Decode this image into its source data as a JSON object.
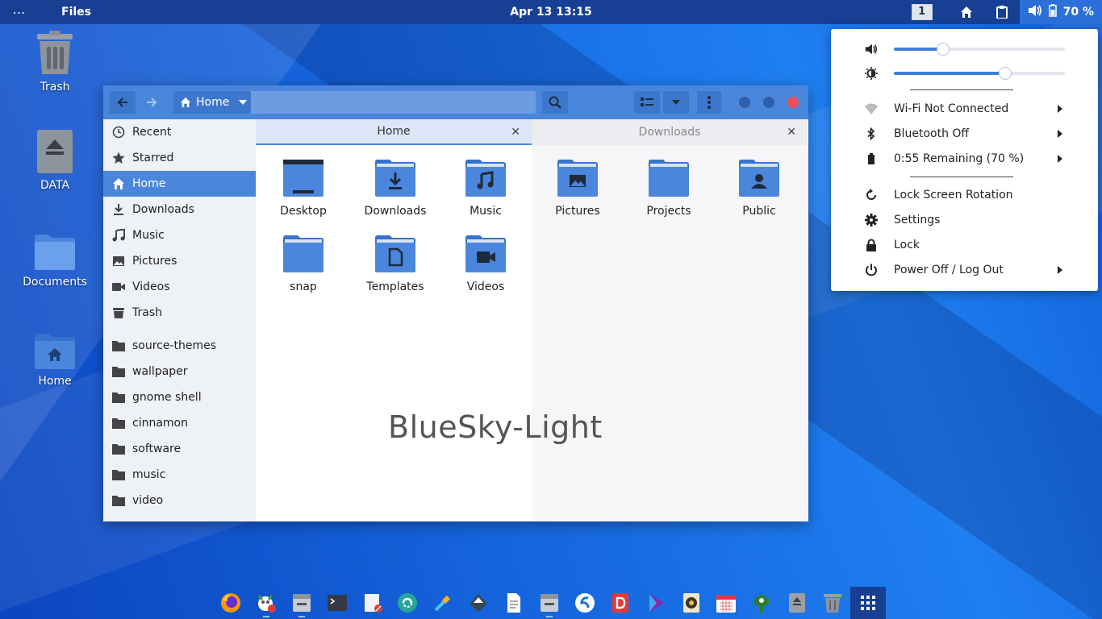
{
  "topbar": {
    "activities_label": "⋯",
    "app_name": "Files",
    "clock": "Apr 13  13:15",
    "workspace": "1",
    "battery": "70 %"
  },
  "desktop_icons": [
    {
      "label": "Trash",
      "icon": "trash-icon"
    },
    {
      "label": "DATA",
      "icon": "drive-icon"
    },
    {
      "label": "Documents",
      "icon": "folder-icon"
    },
    {
      "label": "Home",
      "icon": "home-folder-icon"
    }
  ],
  "window": {
    "path_current": "Home",
    "sidebar": {
      "places": [
        {
          "label": "Recent",
          "icon": "clock-icon"
        },
        {
          "label": "Starred",
          "icon": "star-icon"
        },
        {
          "label": "Home",
          "icon": "home-icon",
          "active": true
        },
        {
          "label": "Downloads",
          "icon": "download-icon"
        },
        {
          "label": "Music",
          "icon": "music-icon"
        },
        {
          "label": "Pictures",
          "icon": "picture-icon"
        },
        {
          "label": "Videos",
          "icon": "video-icon"
        },
        {
          "label": "Trash",
          "icon": "trash-icon"
        }
      ],
      "bookmarks": [
        {
          "label": "source-themes"
        },
        {
          "label": "wallpaper"
        },
        {
          "label": "gnome shell"
        },
        {
          "label": "cinnamon"
        },
        {
          "label": "software"
        },
        {
          "label": "music"
        },
        {
          "label": "video"
        }
      ]
    },
    "tabs": [
      {
        "label": "Home",
        "active": true
      },
      {
        "label": "Downloads",
        "active": false
      }
    ],
    "files": [
      {
        "label": "Desktop",
        "icon": "desktop-folder-icon"
      },
      {
        "label": "Downloads",
        "icon": "downloads-folder-icon"
      },
      {
        "label": "Music",
        "icon": "music-folder-icon"
      },
      {
        "label": "Pictures",
        "icon": "pictures-folder-icon"
      },
      {
        "label": "Projects",
        "icon": "folder-icon"
      },
      {
        "label": "Public",
        "icon": "public-folder-icon"
      },
      {
        "label": "snap",
        "icon": "folder-icon"
      },
      {
        "label": "Templates",
        "icon": "templates-folder-icon"
      },
      {
        "label": "Videos",
        "icon": "videos-folder-icon"
      }
    ],
    "watermark": "BlueSky-Light"
  },
  "system_menu": {
    "volume_level": 0.29,
    "brightness_level": 0.65,
    "items": [
      {
        "label": "Wi-Fi Not Connected",
        "icon": "wifi-icon",
        "submenu": true
      },
      {
        "label": "Bluetooth Off",
        "icon": "bluetooth-icon",
        "submenu": true
      },
      {
        "label": "0:55 Remaining (70 %)",
        "icon": "battery-icon",
        "submenu": true
      },
      {
        "label": "Lock Screen Rotation",
        "icon": "rotation-icon",
        "submenu": false
      },
      {
        "label": "Settings",
        "icon": "gear-icon",
        "submenu": false
      },
      {
        "label": "Lock",
        "icon": "lock-icon",
        "submenu": false
      },
      {
        "label": "Power Off / Log Out",
        "icon": "power-icon",
        "submenu": true
      }
    ]
  },
  "colors": {
    "accent": "#4a86dc",
    "topbar": "#173f93",
    "close_button": "#ef4f5b"
  },
  "dock": [
    {
      "name": "firefox-icon"
    },
    {
      "name": "gimp-icon"
    },
    {
      "name": "files-icon"
    },
    {
      "name": "terminal-icon"
    },
    {
      "name": "text-editor-icon"
    },
    {
      "name": "recycle-app-icon"
    },
    {
      "name": "color-picker-icon"
    },
    {
      "name": "inkscape-icon"
    },
    {
      "name": "document-icon"
    },
    {
      "name": "files-alt-icon"
    },
    {
      "name": "simplenote-icon"
    },
    {
      "name": "d-app-icon"
    },
    {
      "name": "media-player-icon"
    },
    {
      "name": "speaker-icon"
    },
    {
      "name": "calendar-icon"
    },
    {
      "name": "geary-icon"
    },
    {
      "name": "drive-eject-icon"
    },
    {
      "name": "trash-icon"
    },
    {
      "name": "show-apps-icon"
    }
  ]
}
